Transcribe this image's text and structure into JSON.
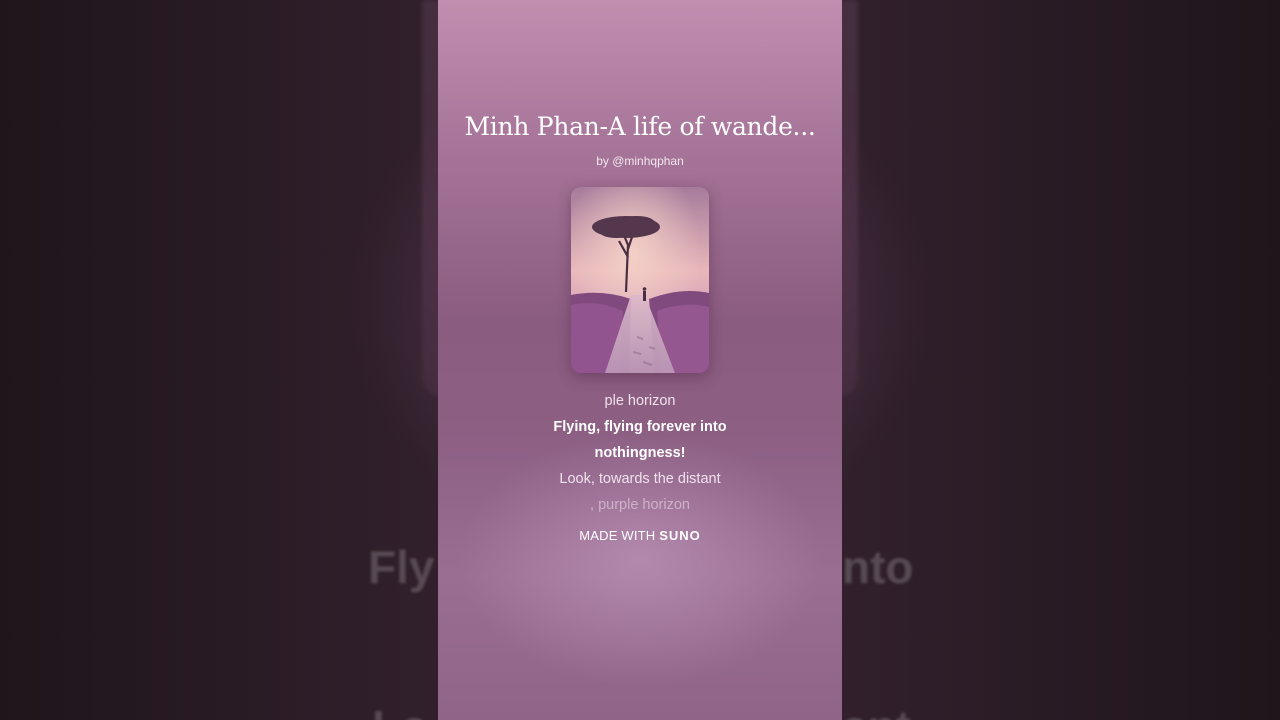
{
  "song": {
    "title": "Minh Phan-A life of wande...",
    "byline": "by @minhqphan"
  },
  "cover": {
    "icon": "album-cover-tree-path-image"
  },
  "lyrics": {
    "previous": "ple horizon",
    "current_1": "Flying, flying forever into",
    "current_2": "nothingness!",
    "next": "Look, towards the distant",
    "upcoming": ", purple horizon"
  },
  "footer": {
    "made_with": "MADE WITH",
    "brand": "SUNO"
  },
  "background": {
    "left_text": "Fly",
    "right_text": "nto",
    "bottom_left_text": "Lo",
    "bottom_right_text": "ant"
  },
  "colors": {
    "panel_top": "#c08fb0",
    "panel_mid": "#8a5c80",
    "text": "#ffffff"
  }
}
